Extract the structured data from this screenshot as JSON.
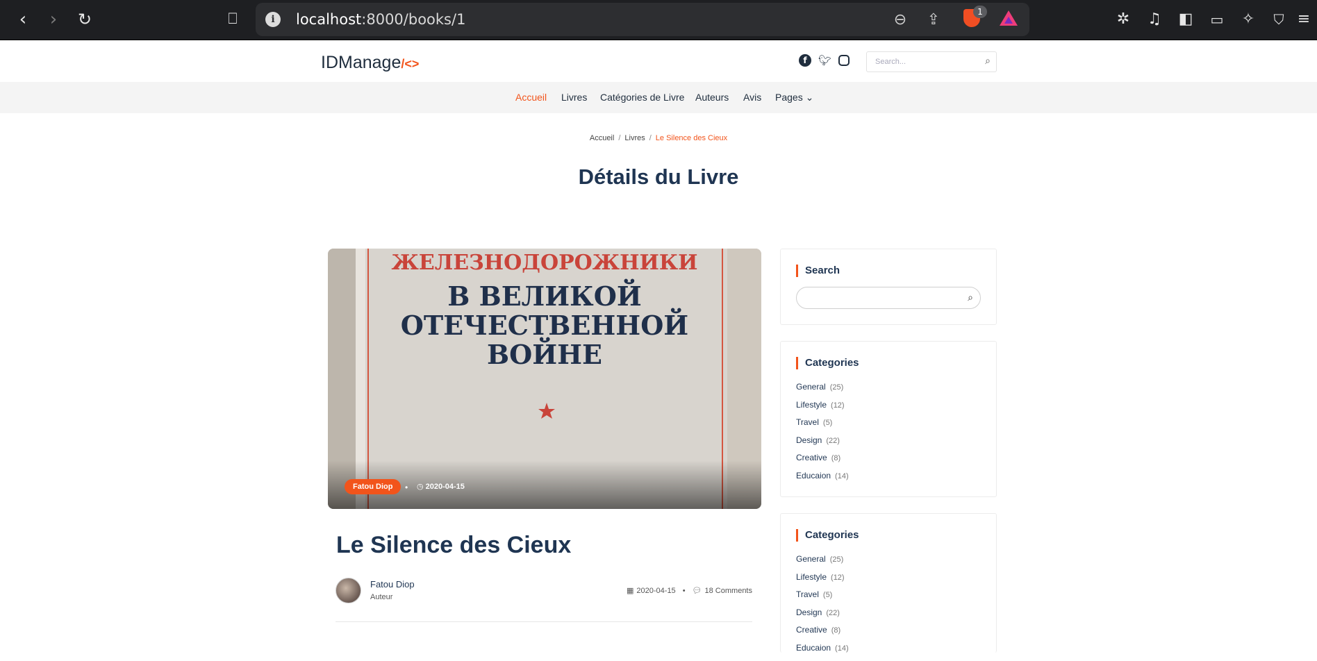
{
  "browser": {
    "url_host": "localhost",
    "url_path": ":8000/books/1",
    "shield_count": "1"
  },
  "site": {
    "logo_text": "IDManage",
    "logo_code": "/<>",
    "search_placeholder": "Search..."
  },
  "nav": {
    "items": [
      {
        "label": "Accueil",
        "active": true
      },
      {
        "label": "Livres"
      },
      {
        "label": "Catégories de Livre"
      },
      {
        "label": "Auteurs"
      },
      {
        "label": "Avis"
      },
      {
        "label": "Pages ⌄"
      }
    ]
  },
  "breadcrumb": {
    "items": [
      "Accueil",
      "Livres"
    ],
    "current": "Le Silence des Cieux"
  },
  "page_title": "Détails du Livre",
  "hero": {
    "cover_line1": "ЖЕЛЕЗНОДОРОЖНИКИ",
    "cover_line2": "В ВЕЛИКОЙ",
    "cover_line3": "ОТЕЧЕСТВЕННОЙ",
    "cover_line4": "ВОЙНЕ",
    "badge": "Fatou Diop",
    "date": "2020-04-15"
  },
  "book": {
    "title": "Le Silence des Cieux",
    "author_name": "Fatou Diop",
    "author_role": "Auteur",
    "date": "2020-04-15",
    "comments": "18 Comments"
  },
  "sidebar": {
    "search_title": "Search",
    "categories_title": "Categories",
    "categories": [
      {
        "name": "General",
        "count": "(25)"
      },
      {
        "name": "Lifestyle",
        "count": "(12)"
      },
      {
        "name": "Travel",
        "count": "(5)"
      },
      {
        "name": "Design",
        "count": "(22)"
      },
      {
        "name": "Creative",
        "count": "(8)"
      },
      {
        "name": "Educaion",
        "count": "(14)"
      }
    ]
  },
  "colors": {
    "accent": "#f2541b",
    "heading": "#1f3552",
    "browser_bg": "#1e1f22"
  }
}
